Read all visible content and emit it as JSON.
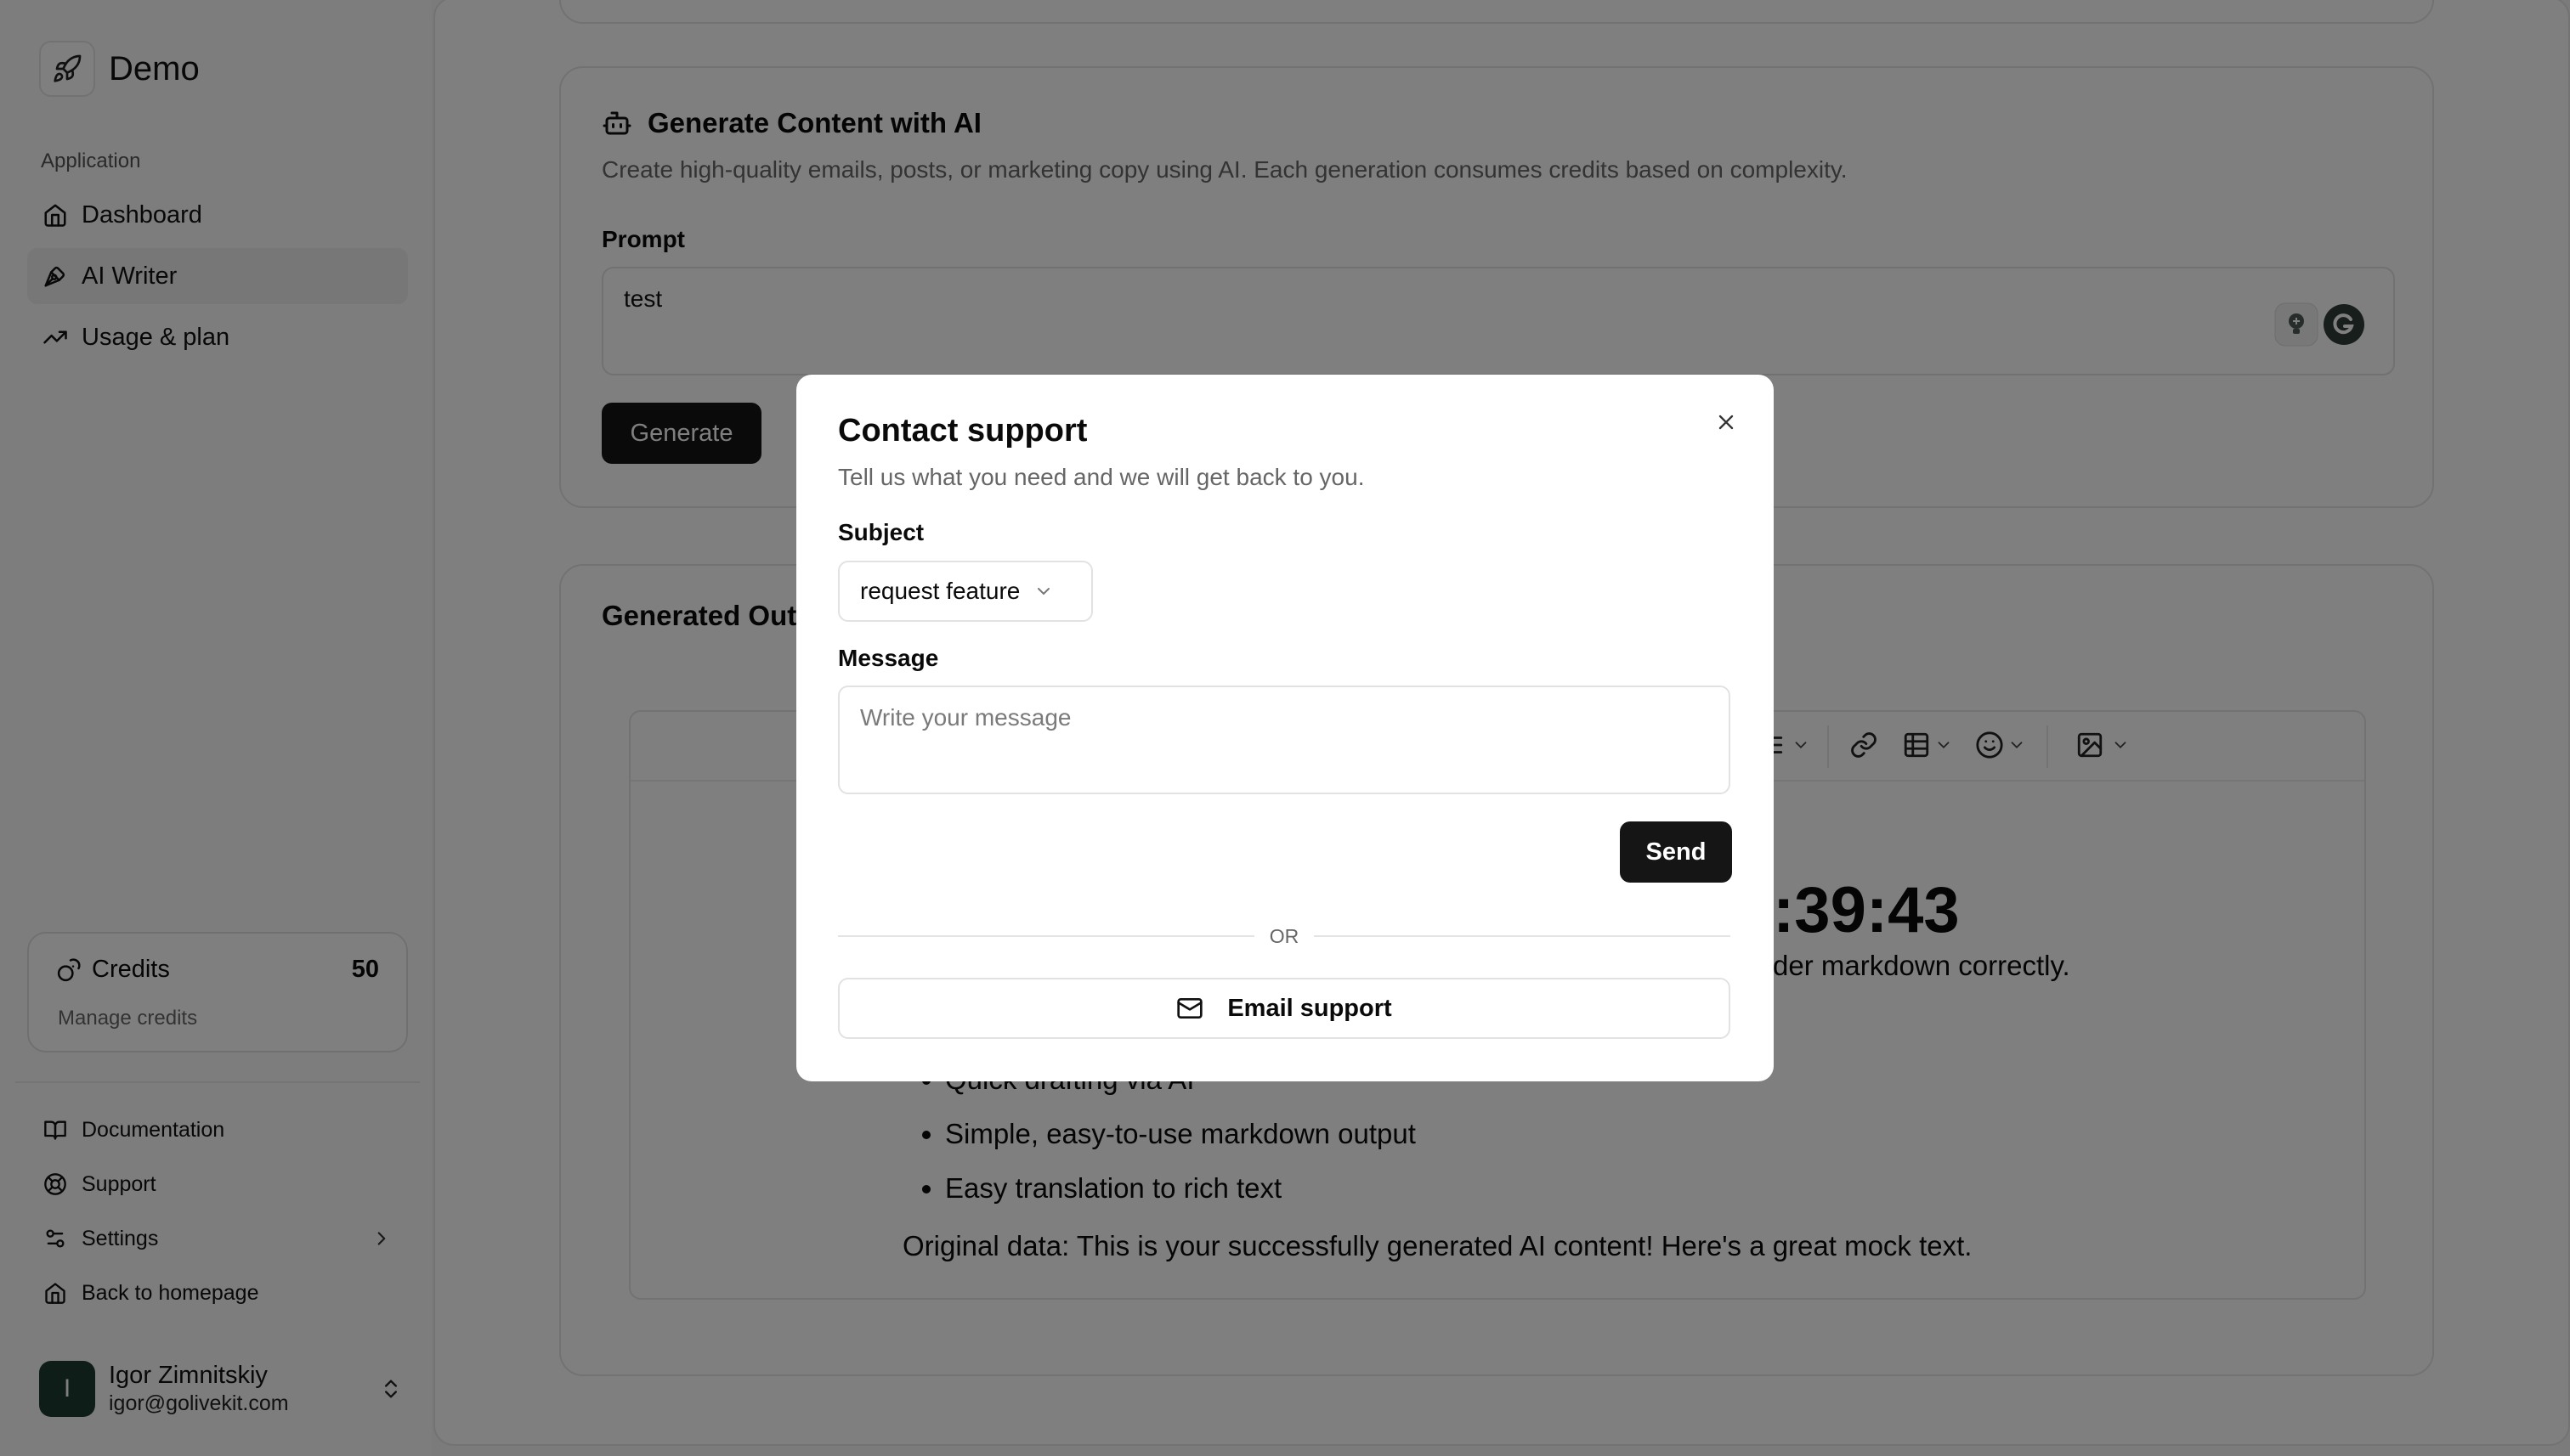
{
  "sidebar": {
    "brand": "Demo",
    "group_label": "Application",
    "nav": [
      {
        "label": "Dashboard",
        "icon": "home-icon"
      },
      {
        "label": "AI Writer",
        "icon": "pen-icon",
        "active": true
      },
      {
        "label": "Usage & plan",
        "icon": "trending-up-icon"
      }
    ],
    "credits": {
      "label": "Credits",
      "value": "50",
      "manage": "Manage credits"
    },
    "secondary": [
      {
        "label": "Documentation",
        "icon": "book-icon"
      },
      {
        "label": "Support",
        "icon": "lifebuoy-icon"
      },
      {
        "label": "Settings",
        "icon": "settings-sliders-icon"
      },
      {
        "label": "Back to homepage",
        "icon": "home-icon"
      }
    ],
    "user": {
      "initial": "I",
      "name": "Igor Zimnitskiy",
      "email": "igor@golivekit.com"
    }
  },
  "generate": {
    "title": "Generate Content with AI",
    "description": "Create high-quality emails, posts, or marketing copy using AI. Each generation consumes credits based on complexity.",
    "prompt_label": "Prompt",
    "prompt_value": "test",
    "button": "Generate"
  },
  "output": {
    "title": "Generated Out",
    "heading_tail": ":39:43",
    "text_tail": "der markdown correctly.",
    "bullets": [
      "Quick drafting via AI",
      "Simple, easy-to-use markdown output",
      "Easy translation to rich text"
    ],
    "original": "Original data: This is your successfully generated AI content! Here's a great mock text."
  },
  "modal": {
    "title": "Contact support",
    "subtitle": "Tell us what you need and we will get back to you.",
    "subject_label": "Subject",
    "subject_value": "request feature",
    "message_label": "Message",
    "message_placeholder": "Write your message",
    "send": "Send",
    "or": "OR",
    "email_button": "Email support"
  },
  "colors": {
    "primary_button": "#151515",
    "overlay": "rgba(0,0,0,0.5)",
    "avatar_bg": "#1f3a33"
  }
}
